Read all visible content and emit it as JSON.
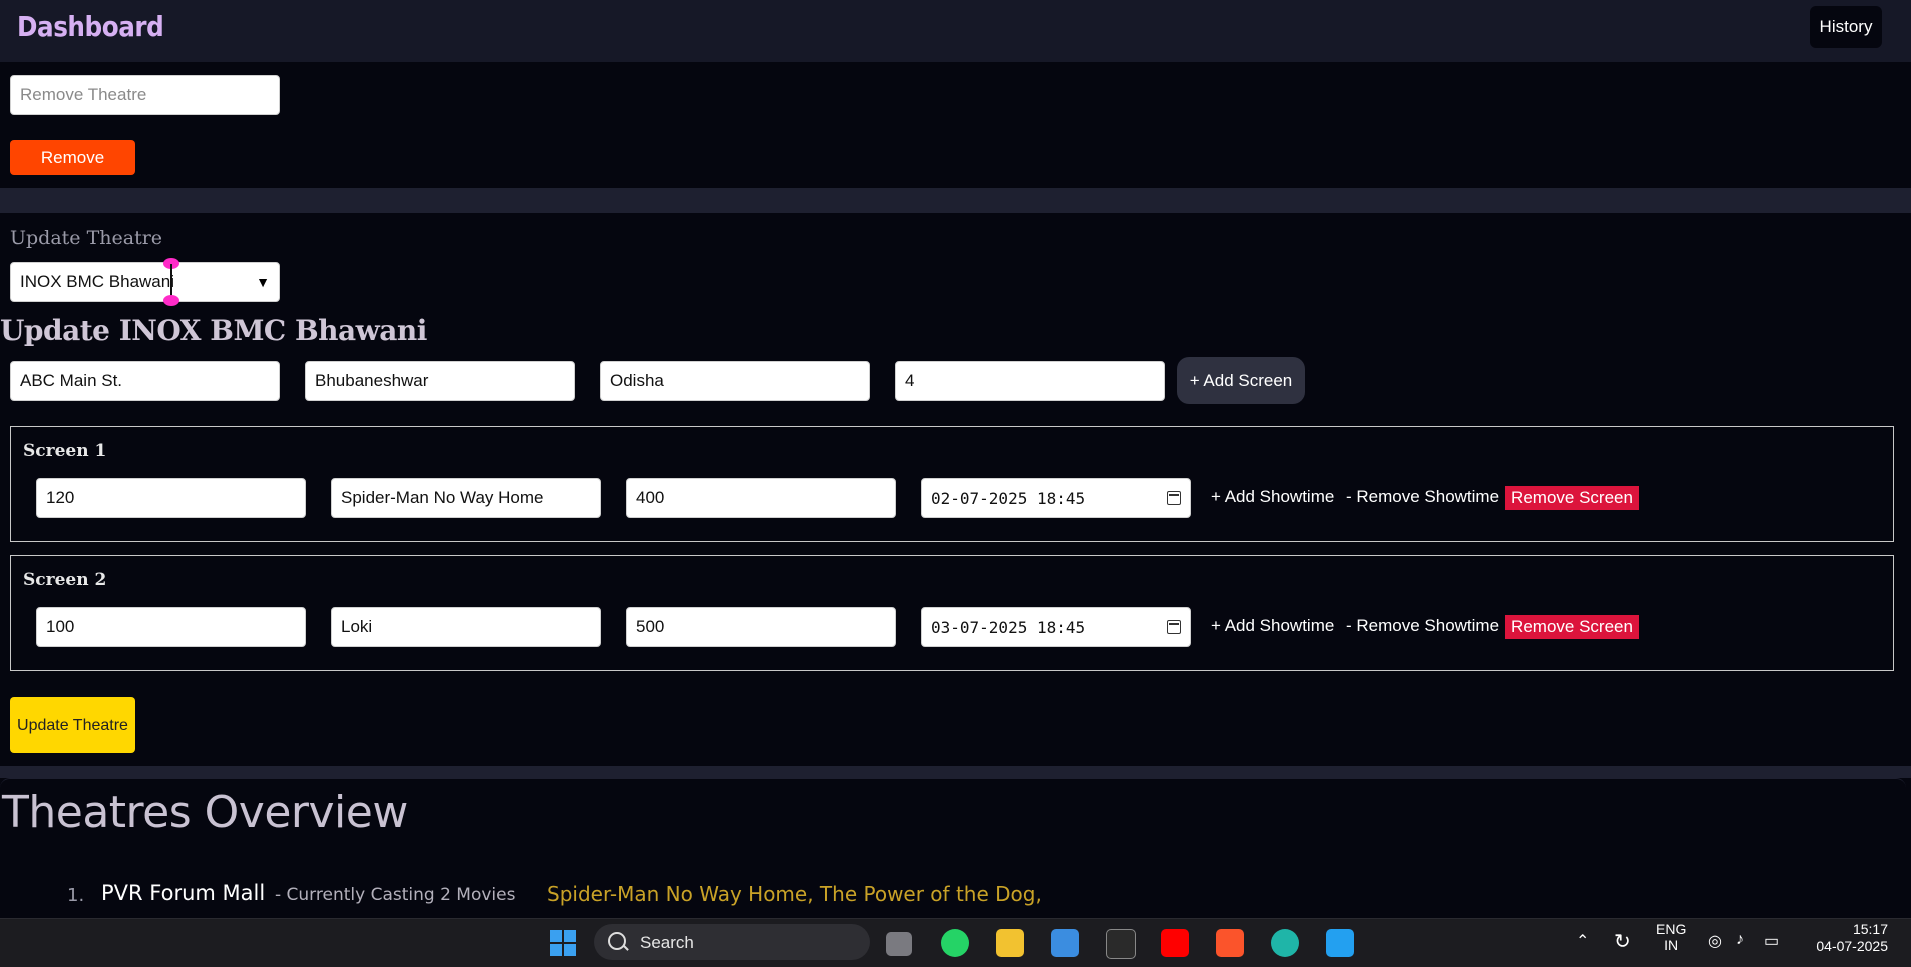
{
  "header": {
    "title": "Dashboard",
    "history_label": "History"
  },
  "remove_section": {
    "placeholder": "Remove Theatre",
    "remove_label": "Remove"
  },
  "update_section": {
    "label": "Update Theatre",
    "selected_theatre": "INOX BMC Bhawani",
    "heading": "Update INOX BMC Bhawani",
    "address": "ABC Main St.",
    "city": "Bhubaneshwar",
    "state": "Odisha",
    "screen_count": "4",
    "add_screen_label": "+ Add Screen",
    "screens": [
      {
        "title": "Screen 1",
        "seats": "120",
        "movie": "Spider-Man No Way Home",
        "price": "400",
        "showtime": "02-07-2025 18:45"
      },
      {
        "title": "Screen 2",
        "seats": "100",
        "movie": "Loki",
        "price": "500",
        "showtime": "03-07-2025 18:45"
      }
    ],
    "add_showtime_label": "+ Add Showtime",
    "remove_showtime_label": "- Remove Showtime",
    "remove_screen_label": "Remove Screen",
    "update_button_label": "Update Theatre"
  },
  "overview": {
    "title": "Theatres Overview",
    "items": [
      {
        "num": "1.",
        "name": "PVR Forum Mall",
        "count": "- Currently Casting 2 Movies",
        "movies": "Spider-Man No Way Home,  The Power of the Dog,"
      }
    ]
  },
  "taskbar": {
    "search_label": "Search",
    "lang_line1": "ENG",
    "lang_line2": "IN",
    "time": "15:17",
    "date": "04-07-2025"
  }
}
